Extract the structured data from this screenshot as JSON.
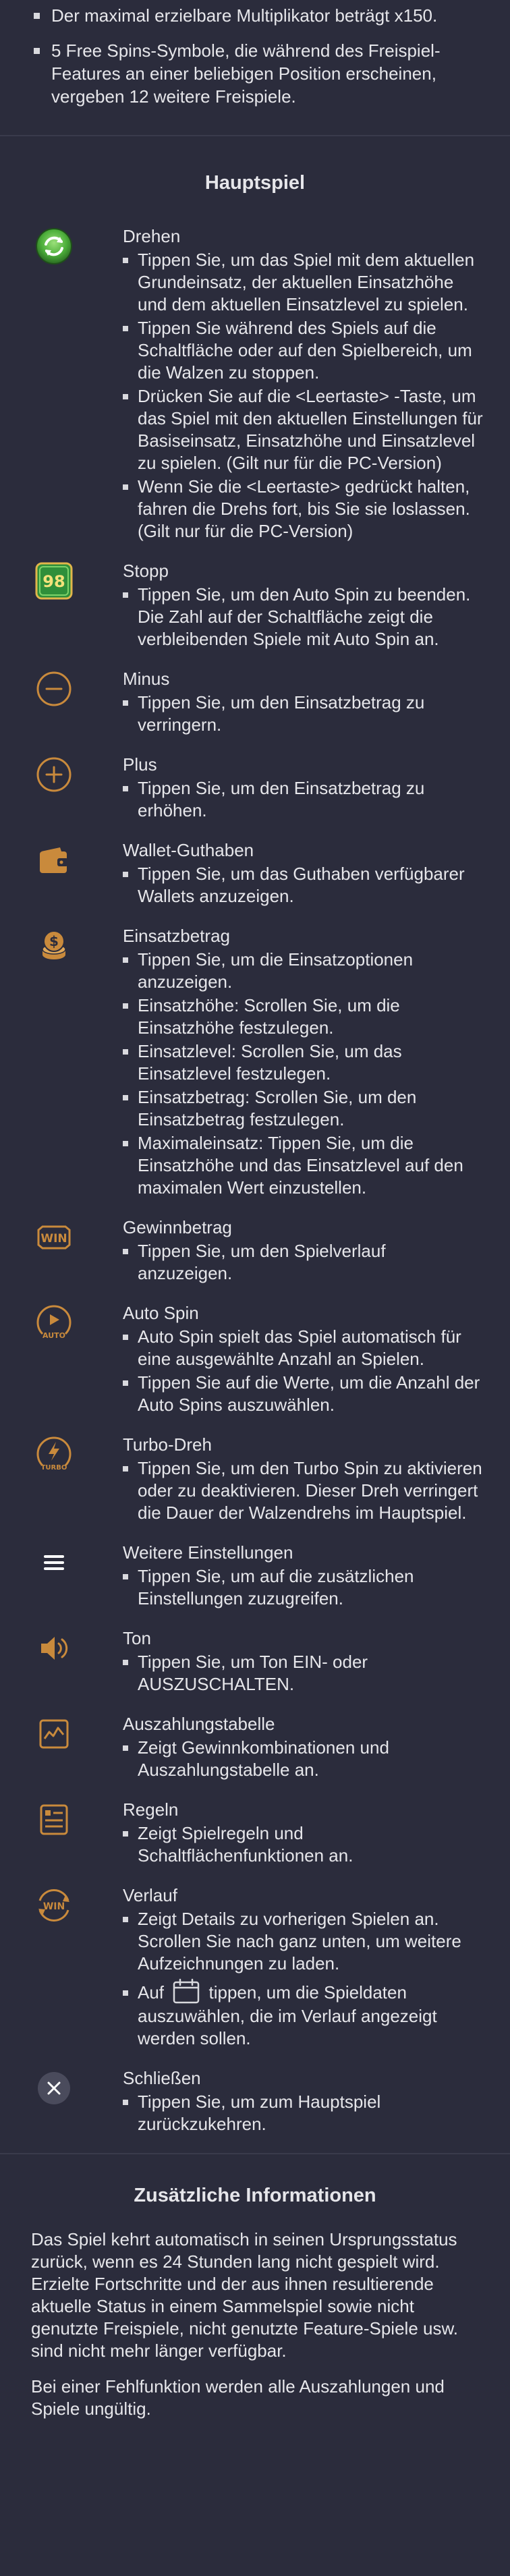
{
  "top": {
    "bullets": [
      "Der maximal erzielbare Multiplikator beträgt x150.",
      "5 Free Spins-Symbole, die während des Freispiel-Features an einer beliebigen Position erscheinen, vergeben 12 weitere Freispiele."
    ]
  },
  "hauptspiel": {
    "heading": "Hauptspiel",
    "items": [
      {
        "icon": "spin-icon",
        "title": "Drehen",
        "bullets": [
          "Tippen Sie, um das Spiel mit dem aktuellen Grundeinsatz, der aktuellen Einsatzhöhe und dem aktuellen Einsatzlevel zu spielen.",
          "Tippen Sie während des Spiels auf die Schaltfläche oder auf den Spielbereich, um die Walzen zu stoppen.",
          "Drücken Sie auf die <Leertaste> -Taste, um das Spiel mit den aktuellen Einstellungen für Basiseinsatz, Einsatzhöhe und Einsatzlevel zu spielen. (Gilt nur für die PC-Version)",
          "Wenn Sie die <Leertaste> gedrückt halten, fahren die Drehs fort, bis Sie sie loslassen. (Gilt nur für die PC-Version)"
        ]
      },
      {
        "icon": "stop-icon",
        "icon_text": "98",
        "title": "Stopp",
        "bullets": [
          "Tippen Sie, um den Auto Spin zu beenden. Die Zahl auf der Schaltfläche zeigt die verbleibenden Spiele mit Auto Spin an."
        ]
      },
      {
        "icon": "minus-icon",
        "title": "Minus",
        "bullets": [
          "Tippen Sie, um den Einsatzbetrag zu verringern."
        ]
      },
      {
        "icon": "plus-icon",
        "title": "Plus",
        "bullets": [
          "Tippen Sie, um den Einsatzbetrag zu erhöhen."
        ]
      },
      {
        "icon": "wallet-icon",
        "title": "Wallet-Guthaben",
        "bullets": [
          "Tippen Sie, um das Guthaben verfügbarer Wallets anzuzeigen."
        ]
      },
      {
        "icon": "coins-icon",
        "title": "Einsatzbetrag",
        "bullets": [
          "Tippen Sie, um die Einsatzoptionen anzuzeigen.",
          "Einsatzhöhe: Scrollen Sie, um die Einsatzhöhe festzulegen.",
          "Einsatzlevel: Scrollen Sie, um das Einsatzlevel festzulegen.",
          "Einsatzbetrag: Scrollen Sie, um den Einsatzbetrag festzulegen.",
          "Maximaleinsatz: Tippen Sie, um die Einsatzhöhe und das Einsatzlevel auf den maximalen Wert einzustellen."
        ]
      },
      {
        "icon": "win-icon",
        "icon_text": "WIN",
        "title": "Gewinnbetrag",
        "bullets": [
          "Tippen Sie, um den Spielverlauf anzuzeigen."
        ]
      },
      {
        "icon": "auto-spin-icon",
        "icon_text": "AUTO",
        "title": "Auto Spin",
        "bullets": [
          "Auto Spin spielt das Spiel automatisch für eine ausgewählte Anzahl an Spielen.",
          "Tippen Sie auf die Werte, um die Anzahl der Auto Spins auszuwählen."
        ]
      },
      {
        "icon": "turbo-icon",
        "icon_text": "TURBO",
        "title": "Turbo-Dreh",
        "bullets": [
          "Tippen Sie, um den Turbo Spin zu aktivieren oder zu deaktivieren. Dieser Dreh verringert die Dauer der Walzendrehs im Hauptspiel."
        ]
      },
      {
        "icon": "menu-icon",
        "title": "Weitere Einstellungen",
        "bullets": [
          "Tippen Sie, um auf die zusätzlichen Einstellungen zuzugreifen."
        ]
      },
      {
        "icon": "speaker-icon",
        "title": "Ton",
        "bullets": [
          "Tippen Sie, um Ton EIN- oder AUSZUSCHALTEN."
        ]
      },
      {
        "icon": "paytable-icon",
        "title": "Auszahlungstabelle",
        "bullets": [
          "Zeigt Gewinnkombinationen und Auszahlungstabelle an."
        ]
      },
      {
        "icon": "rules-icon",
        "title": "Regeln",
        "bullets": [
          "Zeigt Spielregeln und Schaltflächenfunktionen an."
        ]
      },
      {
        "icon": "history-icon",
        "icon_text": "WIN",
        "title": "Verlauf",
        "bullets": [
          "Zeigt Details zu vorherigen Spielen an. Scrollen Sie nach ganz unten, um weitere Aufzeichnungen zu laden."
        ],
        "calendar_bullet": {
          "before": "Auf",
          "after": "tippen, um die Spieldaten auszuwählen, die im Verlauf angezeigt werden sollen."
        }
      },
      {
        "icon": "close-icon",
        "title": "Schließen",
        "bullets": [
          "Tippen Sie, um zum Hauptspiel zurückzukehren."
        ]
      }
    ]
  },
  "zusaetzlich": {
    "heading": "Zusätzliche Informationen",
    "paragraphs": [
      "Das Spiel kehrt automatisch in seinen Ursprungsstatus zurück, wenn es 24 Stunden lang nicht gespielt wird. Erzielte Fortschritte und der aus ihnen resultierende aktuelle Status in einem Sammelspiel sowie nicht genutzte Freispiele, nicht genutzte Feature-Spiele usw. sind nicht mehr länger verfügbar.",
      "Bei einer Fehlfunktion werden alle Auszahlungen und Spiele ungültig."
    ]
  },
  "colors": {
    "background": "#2b2c3c",
    "accent": "#c98a3c",
    "text": "#e6e6ea",
    "spin_green": "#4cae3a",
    "stop_green": "#2f8f3a"
  }
}
